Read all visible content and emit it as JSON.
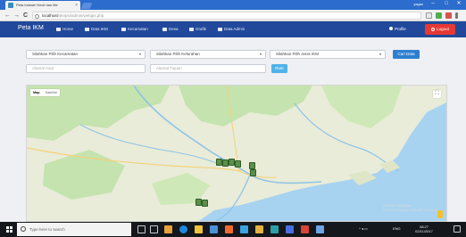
{
  "browser": {
    "tab_title": "Peta Industri Kecil dan Me",
    "tab_close": "×",
    "window_user": "yagas",
    "minimize": "–",
    "maximize": "□",
    "close": "✕",
    "back": "←",
    "forward": "→",
    "reload": "C",
    "url_host": "localhost",
    "url_path": "/skripsi/admin/webgis.php"
  },
  "app": {
    "brand": "Peta IKM",
    "nav": [
      {
        "label": "Home"
      },
      {
        "label": "Data IKM"
      },
      {
        "label": "Kecamatan"
      },
      {
        "label": "Desa"
      },
      {
        "label": "Grafik"
      },
      {
        "label": "Data Admin"
      }
    ],
    "profile": "Profile",
    "logout": "Logout"
  },
  "filters": {
    "kecamatan": "Silahkan Pilih Kecamatan",
    "kelurahan": "Silahkan Pilih Kelurahan",
    "jenis_ikm": "Silahkan Pilih Jenis IKM",
    "cari_button": "Cari Data",
    "alamat_asal_placeholder": "Alamat Asal",
    "alamat_tujuan_placeholder": "Alamat Tujuan",
    "rute_button": "Rute",
    "caret": "▾"
  },
  "map": {
    "map_type_active": "Map",
    "map_type_other": "Satellite",
    "fullscreen_icon": "⛶",
    "watermark_line1": "Activate Windows",
    "watermark_line2": "Go to Settings to activate Windows."
  },
  "taskbar": {
    "search_placeholder": "Type here to search",
    "language": "ENG",
    "time": "08:27",
    "date": "02/11/2017"
  },
  "colors": {
    "navbar": "#21489a",
    "logout": "#e53935",
    "primary_button": "#2e7fd0",
    "info_button": "#4fb3e8",
    "sea": "#a8d3f0",
    "land": "#e9ecd8",
    "forest": "#c4e3ae",
    "marker": "#5b8f4a"
  }
}
